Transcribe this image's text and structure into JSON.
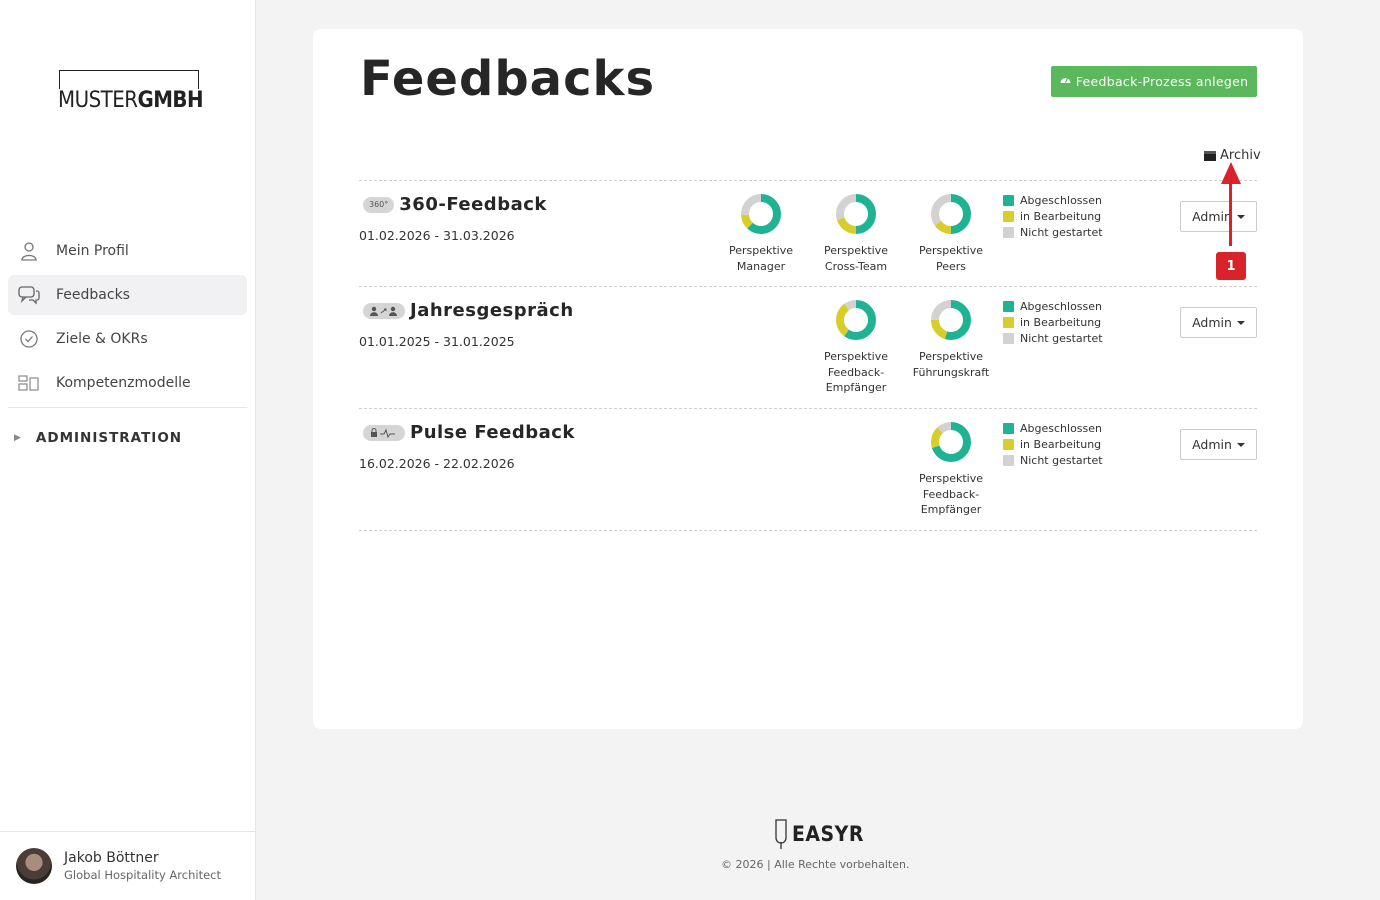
{
  "brand": {
    "logo_thin": "MUSTER",
    "logo_bold": "GMBH"
  },
  "sidebar": {
    "items": [
      {
        "label": "Mein Profil",
        "icon": "user-icon"
      },
      {
        "label": "Feedbacks",
        "icon": "chat-icon",
        "active": true
      },
      {
        "label": "Ziele & OKRs",
        "icon": "check-circle-icon"
      },
      {
        "label": "Kompetenzmodelle",
        "icon": "model-icon"
      }
    ],
    "admin_section": "ADMINISTRATION"
  },
  "user": {
    "name": "Jakob Böttner",
    "role": "Global Hospitality Architect"
  },
  "main": {
    "title": "Feedbacks",
    "create_button": "Feedback-Prozess anlegen",
    "archive_link": "Archiv",
    "legend": [
      "Abgeschlossen",
      "in Bearbeitung",
      "Nicht gestartet"
    ],
    "admin_button": "Admin"
  },
  "colors": {
    "completed": "#1fb394",
    "in_progress": "#d7cd2b",
    "not_started": "#d2d2d2",
    "accent_button": "#5cb85c",
    "annotation": "#d9232a"
  },
  "processes": [
    {
      "name": "360-Feedback",
      "badge": "360°",
      "dates": "01.02.2026 - 31.03.2026",
      "perspectives": [
        {
          "label_lines": [
            "Perspektive",
            "Manager"
          ],
          "completed": 0.62,
          "in_progress": 0.12,
          "not_started": 0.26
        },
        {
          "label_lines": [
            "Perspektive",
            "Cross-Team"
          ],
          "completed": 0.5,
          "in_progress": 0.2,
          "not_started": 0.3
        },
        {
          "label_lines": [
            "Perspektive",
            "Peers"
          ],
          "completed": 0.5,
          "in_progress": 0.15,
          "not_started": 0.35
        }
      ]
    },
    {
      "name": "Jahresgespräch",
      "dates": "01.01.2025 - 31.01.2025",
      "perspectives": [
        {
          "label_lines": [
            "Perspektive",
            "Feedback-",
            "Empfänger"
          ],
          "completed": 0.6,
          "in_progress": 0.3,
          "not_started": 0.1
        },
        {
          "label_lines": [
            "Perspektive",
            "Führungskraft"
          ],
          "completed": 0.55,
          "in_progress": 0.2,
          "not_started": 0.25
        }
      ]
    },
    {
      "name": "Pulse Feedback",
      "dates": "16.02.2026 - 22.02.2026",
      "perspectives": [
        {
          "label_lines": [
            "Perspektive",
            "Feedback-",
            "Empfänger"
          ],
          "completed": 0.7,
          "in_progress": 0.18,
          "not_started": 0.12
        }
      ]
    }
  ],
  "annotation": {
    "badge": "1"
  },
  "footer": {
    "brand": "EASYR",
    "copyright": "© 2026 | Alle Rechte vorbehalten."
  }
}
